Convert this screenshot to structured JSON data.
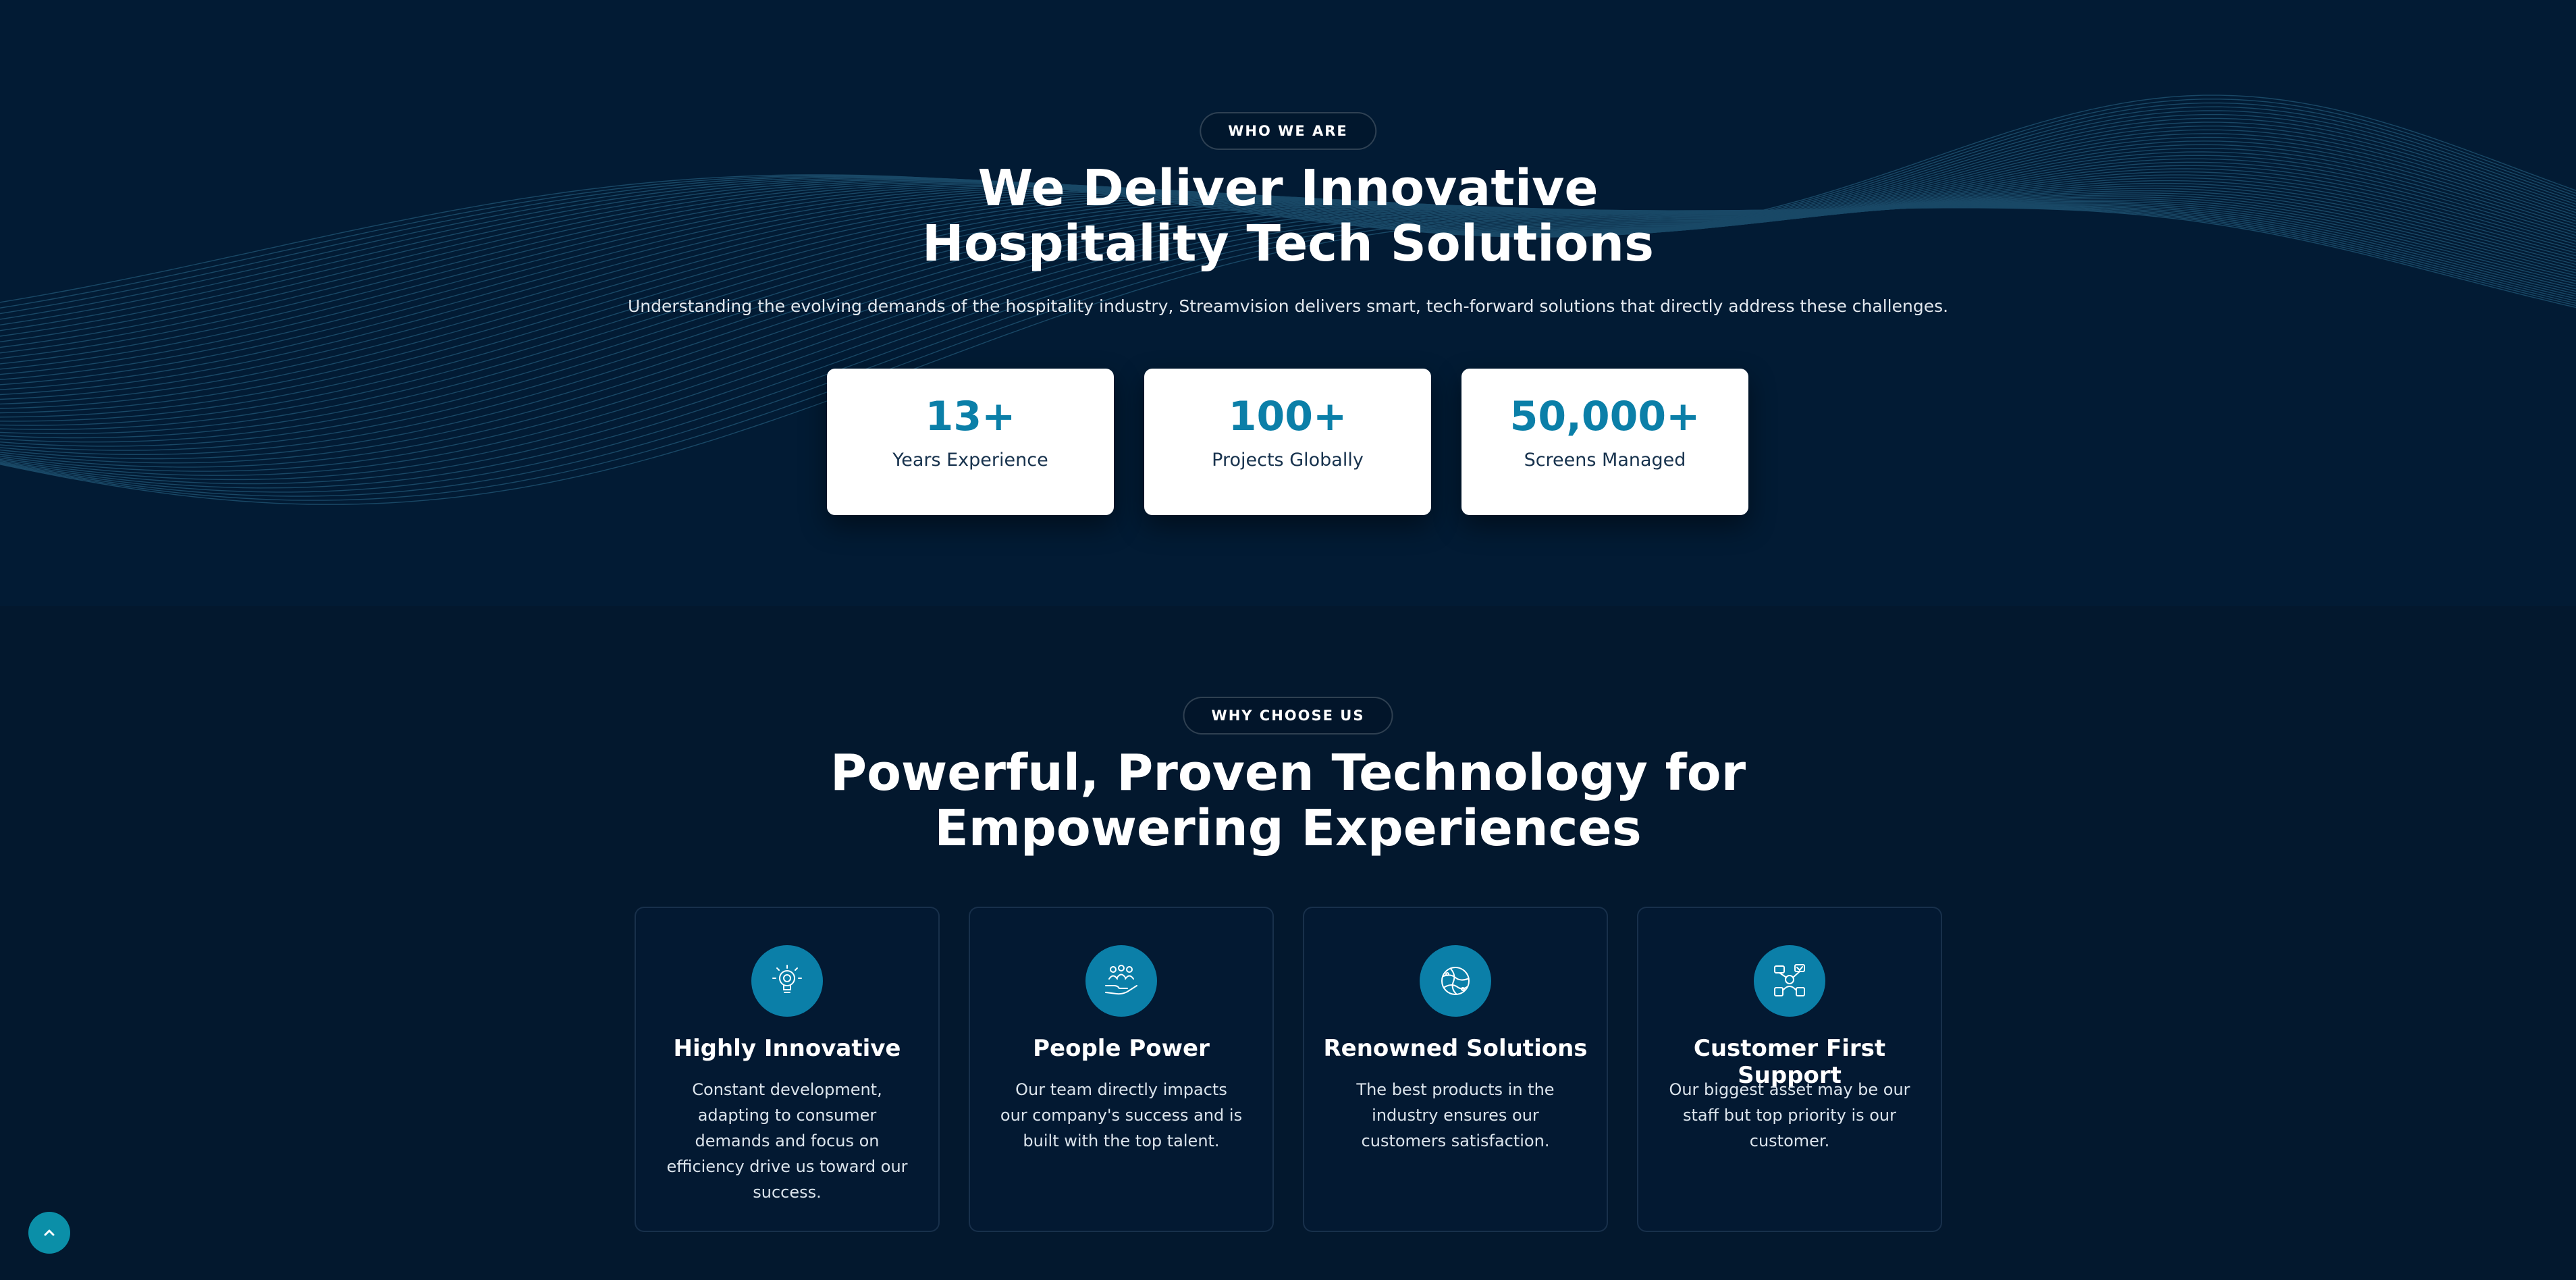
{
  "about": {
    "tag": "WHO WE ARE",
    "title_line1": "We Deliver Innovative",
    "title_line2": "Hospitality Tech Solutions",
    "description": "Understanding the evolving demands of the hospitality industry, Streamvision delivers smart, tech-forward solutions that directly address these challenges.",
    "stats": [
      {
        "value": "13+",
        "label": "Years Experience"
      },
      {
        "value": "100+",
        "label": "Projects Globally"
      },
      {
        "value": "50,000+",
        "label": "Screens Managed"
      }
    ]
  },
  "why": {
    "tag": "WHY CHOOSE US",
    "title_line1": "Powerful, Proven Technology for",
    "title_line2": "Empowering Experiences",
    "features": [
      {
        "icon": "lightbulb-icon",
        "title": "Highly Innovative",
        "text": "Constant development, adapting to consumer demands and focus on efficiency drive us toward our success."
      },
      {
        "icon": "team-hands-icon",
        "title": "People Power",
        "text": "Our team directly impacts our company's success and is built with the top talent."
      },
      {
        "icon": "globe-icon",
        "title": "Renowned Solutions",
        "text": "The best products in the industry ensures our customers satisfaction."
      },
      {
        "icon": "customer-support-icon",
        "title": "Customer First Support",
        "text": "Our biggest asset may be our staff but top priority is our customer."
      }
    ]
  },
  "scroll_top": {
    "icon": "chevron-up-icon"
  },
  "colors": {
    "background_top": "#021b34",
    "background_bottom": "#03182e",
    "accent": "#0b7fa8",
    "stat_label": "#17324d",
    "scroll_button": "#0b8fa8"
  }
}
